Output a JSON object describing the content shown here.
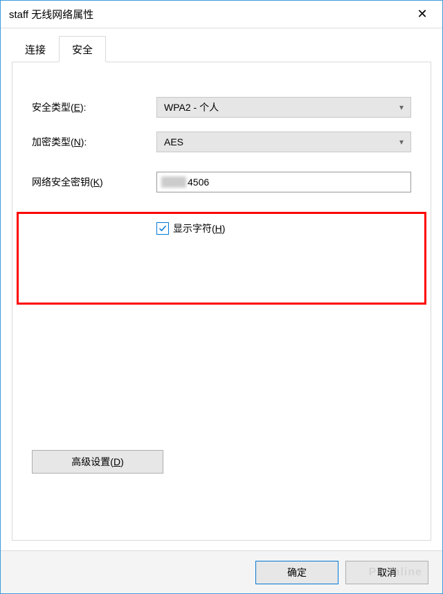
{
  "window": {
    "title": "staff 无线网络属性",
    "close": "✕"
  },
  "tabs": {
    "connection": "连接",
    "security": "安全"
  },
  "fields": {
    "securityTypeLabel": "安全类型(",
    "securityTypeKey": "E",
    "securityTypeClose": "):",
    "securityTypeValue": "WPA2 - 个人",
    "encryptionLabel": "加密类型(",
    "encryptionKey": "N",
    "encryptionClose": "):",
    "encryptionValue": "AES",
    "keyLabel": "网络安全密钥(",
    "keyKey": "K",
    "keyClose": ")",
    "keyValueVisible": "4506",
    "showCharsLabel": "显示字符(",
    "showCharsKey": "H",
    "showCharsClose": ")",
    "showCharsChecked": true
  },
  "buttons": {
    "advancedLabel": "高级设置(",
    "advancedKey": "D",
    "advancedClose": ")",
    "ok": "确定",
    "cancel": "取消"
  },
  "watermark": "PConline"
}
